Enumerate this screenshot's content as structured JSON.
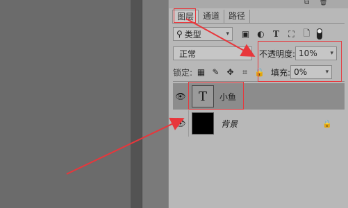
{
  "tabs": [
    "图层",
    "通道",
    "路径"
  ],
  "filter": {
    "kind_label": "类型",
    "icons": [
      "image-filter-icon",
      "adjustment-filter-icon",
      "type-filter-icon",
      "shape-filter-icon",
      "smart-object-filter-icon"
    ]
  },
  "blend": {
    "mode": "正常"
  },
  "opacity": {
    "label": "不透明度:",
    "value": "10%"
  },
  "lock": {
    "label": "锁定:",
    "icons": [
      "lock-transparent-icon",
      "lock-image-icon",
      "lock-position-icon",
      "lock-artboard-icon",
      "lock-all-icon"
    ]
  },
  "fill": {
    "label": "填充:",
    "value": "0%"
  },
  "layers": [
    {
      "name": "小鱼",
      "type": "text",
      "thumb_glyph": "T",
      "selected": true
    },
    {
      "name": "背景",
      "type": "background",
      "locked": true,
      "selected": false
    }
  ],
  "colors": {
    "annotation": "#e8363b",
    "selected_row": "#8c8c8c",
    "panel": "#b8b8b8"
  }
}
